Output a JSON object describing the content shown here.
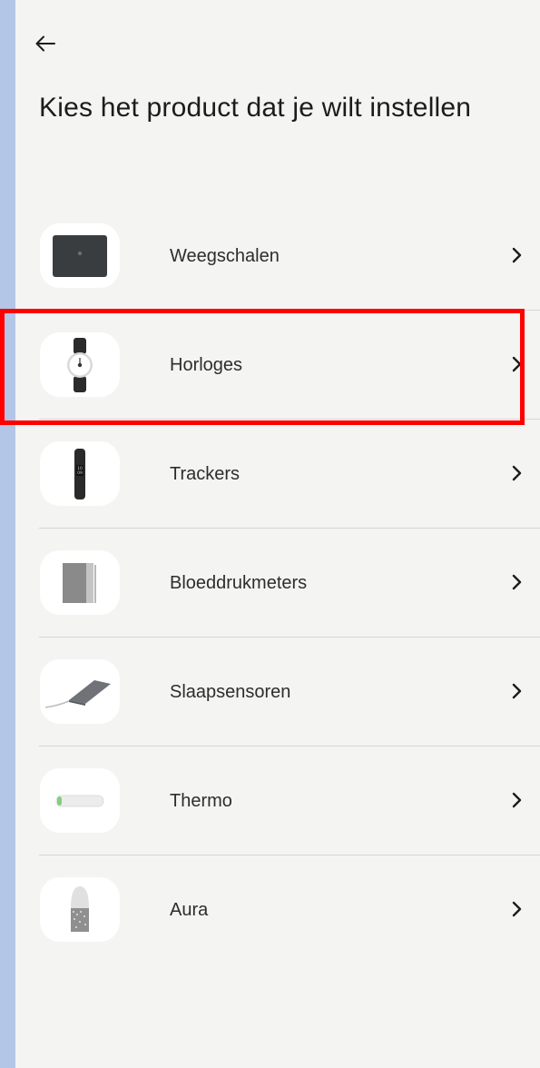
{
  "header": {
    "back_icon": "arrow-left-icon"
  },
  "title": "Kies het product dat je wilt instellen",
  "products": [
    {
      "label": "Weegschalen",
      "icon": "scale-icon"
    },
    {
      "label": "Horloges",
      "icon": "watch-icon"
    },
    {
      "label": "Trackers",
      "icon": "tracker-icon"
    },
    {
      "label": "Bloeddrukmeters",
      "icon": "blood-pressure-monitor-icon"
    },
    {
      "label": "Slaapsensoren",
      "icon": "sleep-sensor-icon"
    },
    {
      "label": "Thermo",
      "icon": "thermometer-icon"
    },
    {
      "label": "Aura",
      "icon": "aura-lamp-icon"
    }
  ],
  "highlight": {
    "color": "#ff0000",
    "item": "Horloges"
  },
  "colors": {
    "background": "#f4f4f3",
    "text": "#1c1c1c",
    "divider": "#d6d6d6",
    "outer": "#b3c6e8"
  }
}
